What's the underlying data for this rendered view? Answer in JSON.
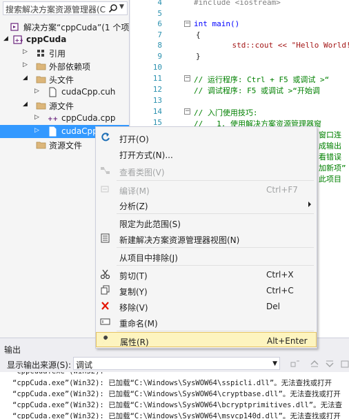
{
  "solution_explorer": {
    "search_placeholder": "搜索解决方案资源管理器(C",
    "items": [
      {
        "label": "解决方案“cppCuda”(1 个项",
        "icon": "solution-icon"
      },
      {
        "label": "cppCuda",
        "icon": "project-icon"
      },
      {
        "label": "引用",
        "icon": "references-icon"
      },
      {
        "label": "外部依赖项",
        "icon": "folder-icon"
      },
      {
        "label": "头文件",
        "icon": "folder-icon"
      },
      {
        "label": "cudaCpp.cuh",
        "icon": "file-icon"
      },
      {
        "label": "源文件",
        "icon": "folder-icon"
      },
      {
        "label": "cppCuda.cpp",
        "icon": "cpp-file-icon"
      },
      {
        "label": "cudaCpp",
        "icon": "file-icon"
      },
      {
        "label": "资源文件",
        "icon": "folder-icon"
      }
    ]
  },
  "editor": {
    "lines": [
      {
        "n": "4",
        "code": "#include <iostream>"
      },
      {
        "n": "5",
        "code": ""
      },
      {
        "n": "6",
        "code": "int main()"
      },
      {
        "n": "7",
        "code": "{"
      },
      {
        "n": "8",
        "code": "    std::cout << \"Hello World!\\n"
      },
      {
        "n": "9",
        "code": "}"
      },
      {
        "n": "10",
        "code": ""
      },
      {
        "n": "11",
        "code": "// 运行程序: Ctrl + F5 或调试 >“"
      },
      {
        "n": "12",
        "code": "// 调试程序: F5 或调试 >“开始调"
      },
      {
        "n": "13",
        "code": ""
      },
      {
        "n": "14",
        "code": "// 入门使用技巧:"
      },
      {
        "n": "15",
        "code": "//   1. 使用解决方案资源管理器窗"
      },
      {
        "n": "16",
        "code": "窗口连"
      },
      {
        "n": "17",
        "code": "成输出"
      },
      {
        "n": "18",
        "code": "看错误"
      },
      {
        "n": "19",
        "code": "加新项”"
      },
      {
        "n": "20",
        "code": "此项目"
      }
    ]
  },
  "context_menu": {
    "items": [
      {
        "label": "打开(O)",
        "shortcut": "",
        "icon": "open-icon",
        "disabled": false
      },
      {
        "label": "打开方式(N)...",
        "shortcut": "",
        "icon": "",
        "disabled": false
      },
      {
        "label": "查看类图(V)",
        "shortcut": "",
        "icon": "class-diagram-icon",
        "disabled": true
      },
      {
        "label": "编译(M)",
        "shortcut": "Ctrl+F7",
        "icon": "compile-icon",
        "disabled": true
      },
      {
        "label": "分析(Z)",
        "shortcut": "",
        "icon": "",
        "disabled": false
      },
      {
        "label": "限定为此范围(S)",
        "shortcut": "",
        "icon": "",
        "disabled": false
      },
      {
        "label": "新建解决方案资源管理器视图(N)",
        "shortcut": "",
        "icon": "new-view-icon",
        "disabled": false
      },
      {
        "label": "从项目中排除(J)",
        "shortcut": "",
        "icon": "",
        "disabled": false
      },
      {
        "label": "剪切(T)",
        "shortcut": "Ctrl+X",
        "icon": "cut-icon",
        "disabled": false
      },
      {
        "label": "复制(Y)",
        "shortcut": "Ctrl+C",
        "icon": "copy-icon",
        "disabled": false
      },
      {
        "label": "移除(V)",
        "shortcut": "Del",
        "icon": "remove-icon",
        "disabled": false
      },
      {
        "label": "重命名(M)",
        "shortcut": "",
        "icon": "rename-icon",
        "disabled": false
      },
      {
        "label": "属性(R)",
        "shortcut": "Alt+Enter",
        "icon": "properties-icon",
        "disabled": false
      }
    ]
  },
  "output": {
    "title": "输出",
    "source_label": "显示输出来源(S):",
    "source_value": "调试",
    "lines": [
      "“cppCuda.exe”(Win32): 已加载“C:\\Windows\\SysWOW64\\sspicli.dll”。无法查找或打开",
      "“cppCuda.exe”(Win32): 已加载“C:\\Windows\\SysWOW64\\cryptbase.dll”。无法查找或打开",
      "“cppCuda.exe”(Win32): 已加载“C:\\Windows\\SysWOW64\\bcryptprimitives.dll”。无法查",
      "“cppCuda.exe”(Win32): 已加载“C:\\Windows\\SysWOW64\\msvcp140d.dll”。无法查找或打开"
    ]
  },
  "colors": {
    "selection": "#3399ff",
    "keyword": "#0000ff",
    "string": "#a31515",
    "comment": "#008000",
    "line_number": "#2b91af",
    "menu_highlight": "#fdf4bf"
  }
}
